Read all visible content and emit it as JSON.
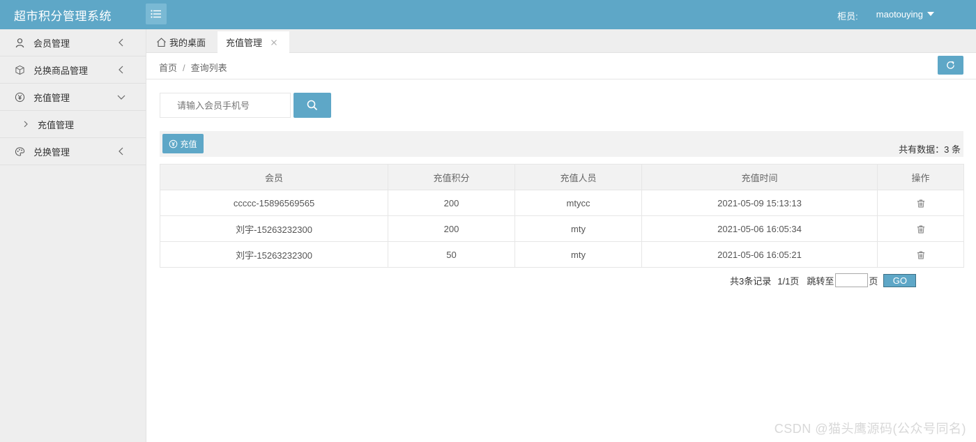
{
  "app": {
    "title": "超市积分管理系统"
  },
  "header": {
    "user_role_label": "柜员:",
    "username": "maotouying"
  },
  "sidebar": {
    "items": [
      {
        "label": "会员管理",
        "icon": "user-icon",
        "state": "collapsed"
      },
      {
        "label": "兑换商品管理",
        "icon": "cube-icon",
        "state": "collapsed"
      },
      {
        "label": "充值管理",
        "icon": "yen-circle-icon",
        "state": "expanded",
        "children": [
          {
            "label": "充值管理"
          }
        ]
      },
      {
        "label": "兑换管理",
        "icon": "palette-icon",
        "state": "collapsed"
      }
    ]
  },
  "tabs": [
    {
      "label": "我的桌面",
      "icon": "home-icon"
    },
    {
      "label": "充值管理",
      "active": true
    }
  ],
  "breadcrumb": {
    "home": "首页",
    "separator": "/",
    "current": "查询列表"
  },
  "search": {
    "placeholder": "请输入会员手机号",
    "value": ""
  },
  "toolbar": {
    "recharge_label": "充值",
    "total_text": "共有数据：3 条"
  },
  "table": {
    "columns": [
      "会员",
      "充值积分",
      "充值人员",
      "充值时间",
      "操作"
    ],
    "rows": [
      {
        "member": "ccccc-15896569565",
        "points": "200",
        "operator": "mtycc",
        "time": "2021-05-09 15:13:13"
      },
      {
        "member": "刘宇-15263232300",
        "points": "200",
        "operator": "mty",
        "time": "2021-05-06 16:05:34"
      },
      {
        "member": "刘宇-15263232300",
        "points": "50",
        "operator": "mty",
        "time": "2021-05-06 16:05:21"
      }
    ]
  },
  "pagination": {
    "total_records": "共3条记录",
    "page_info": "1/1页",
    "jump_label": "跳转至",
    "page_unit": "页",
    "jump_value": "",
    "go_label": "GO"
  },
  "watermark": "CSDN @猫头鹰源码(公众号同名)",
  "colors": {
    "primary": "#5ea7c7",
    "sidebar_bg": "#eeeeee",
    "table_header_bg": "#f2f2f2"
  }
}
